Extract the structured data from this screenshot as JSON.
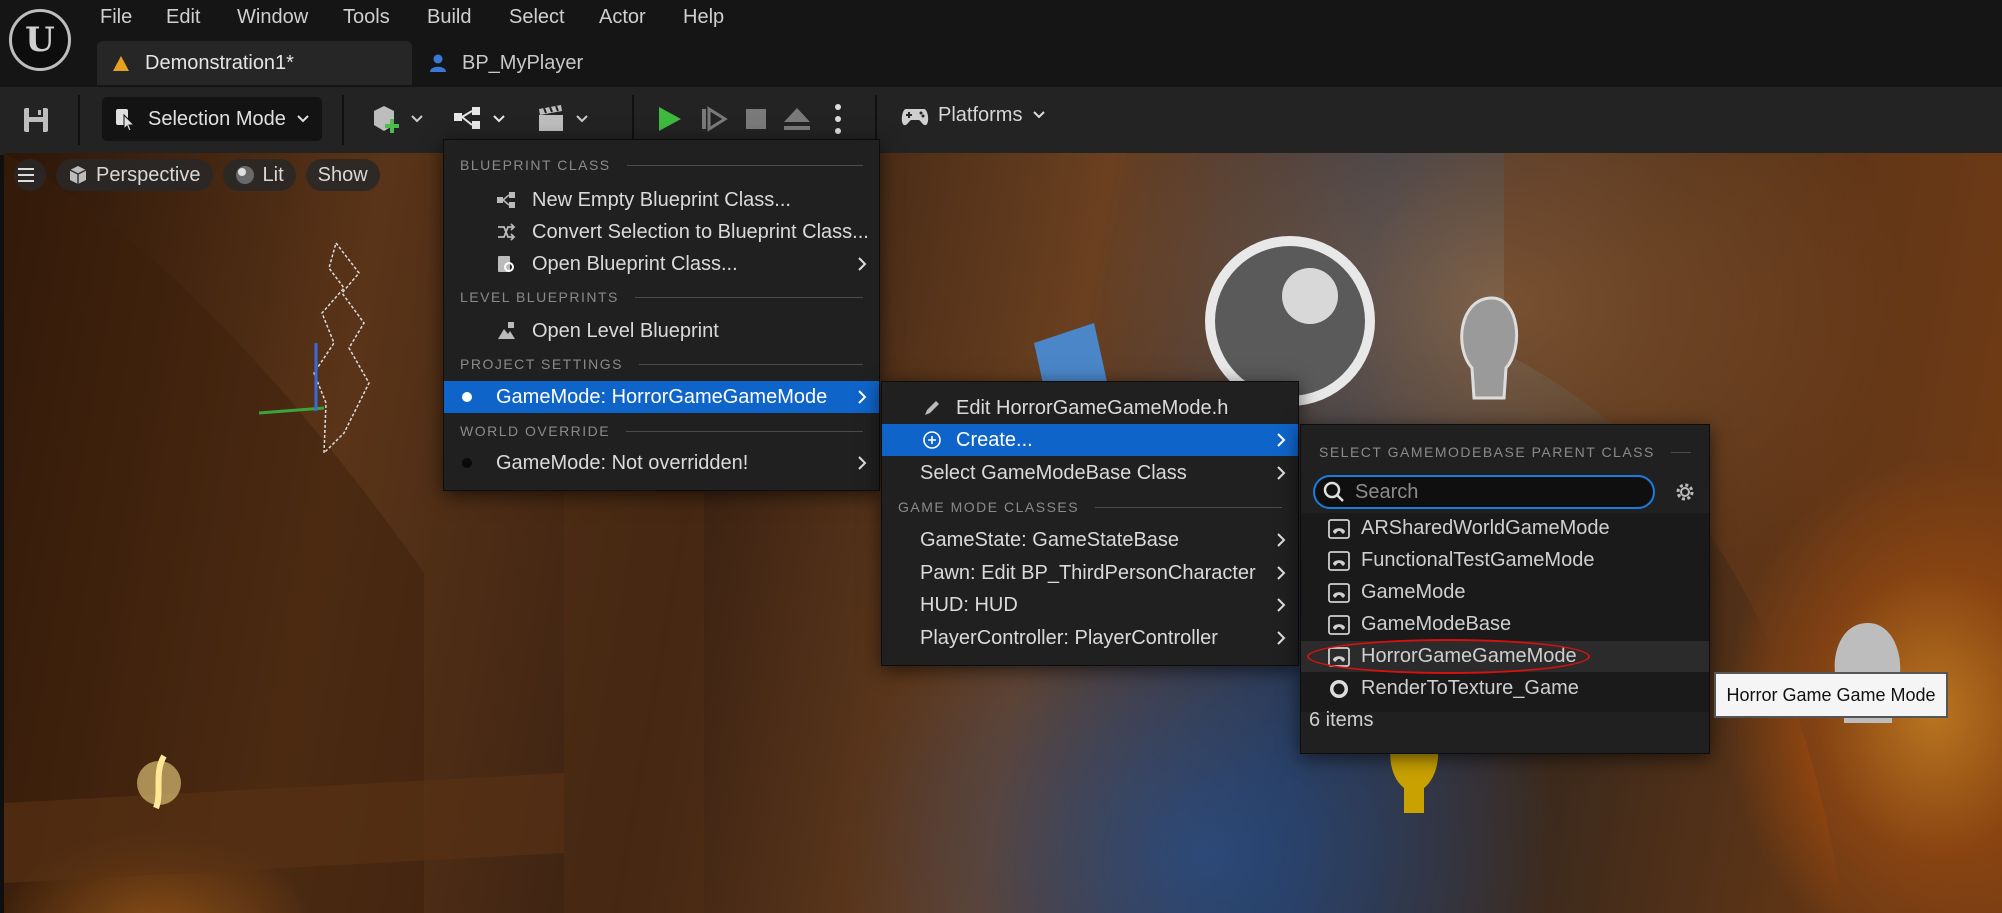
{
  "menubar": {
    "items": [
      "File",
      "Edit",
      "Window",
      "Tools",
      "Build",
      "Select",
      "Actor",
      "Help"
    ]
  },
  "tabs": [
    {
      "label": "Demonstration1*",
      "icon": "level-icon",
      "active": true
    },
    {
      "label": "BP_MyPlayer",
      "icon": "blueprint-character-icon",
      "active": false
    }
  ],
  "toolbar": {
    "selection_mode": "Selection Mode",
    "platforms": "Platforms"
  },
  "viewport": {
    "perspective": "Perspective",
    "lit": "Lit",
    "show": "Show"
  },
  "blueprint_menu": {
    "sections": [
      "BLUEPRINT CLASS",
      "LEVEL BLUEPRINTS",
      "PROJECT SETTINGS",
      "WORLD OVERRIDE"
    ],
    "new_empty": "New Empty Blueprint Class...",
    "convert_selection": "Convert Selection to Blueprint Class...",
    "open_class": "Open Blueprint Class...",
    "open_level": "Open Level Blueprint",
    "gamemode_project": "GameMode: HorrorGameGameMode",
    "gamemode_world": "GameMode: Not overridden!"
  },
  "gamemode_submenu": {
    "edit": "Edit HorrorGameGameMode.h",
    "create": "Create...",
    "select_base": "Select GameModeBase Class",
    "section": "GAME MODE CLASSES",
    "items": [
      "GameState: GameStateBase",
      "Pawn: Edit BP_ThirdPersonCharacter",
      "HUD: HUD",
      "PlayerController: PlayerController"
    ]
  },
  "class_picker": {
    "header": "SELECT GAMEMODEBASE PARENT CLASS",
    "search_placeholder": "Search",
    "items": [
      {
        "label": "ARSharedWorldGameMode",
        "icon": "class-icon"
      },
      {
        "label": "FunctionalTestGameMode",
        "icon": "class-icon"
      },
      {
        "label": "GameMode",
        "icon": "class-icon"
      },
      {
        "label": "GameModeBase",
        "icon": "class-icon"
      },
      {
        "label": "HorrorGameGameMode",
        "icon": "class-icon",
        "highlighted": true
      },
      {
        "label": "RenderToTexture_Game",
        "icon": "sphere-icon"
      }
    ],
    "count": "6 items"
  },
  "tooltip": "Horror Game Game Mode",
  "colors": {
    "selection": "#0e64c9",
    "play": "#3fb93f",
    "annotation": "#d81010",
    "search_focus": "#1b7ce0"
  }
}
